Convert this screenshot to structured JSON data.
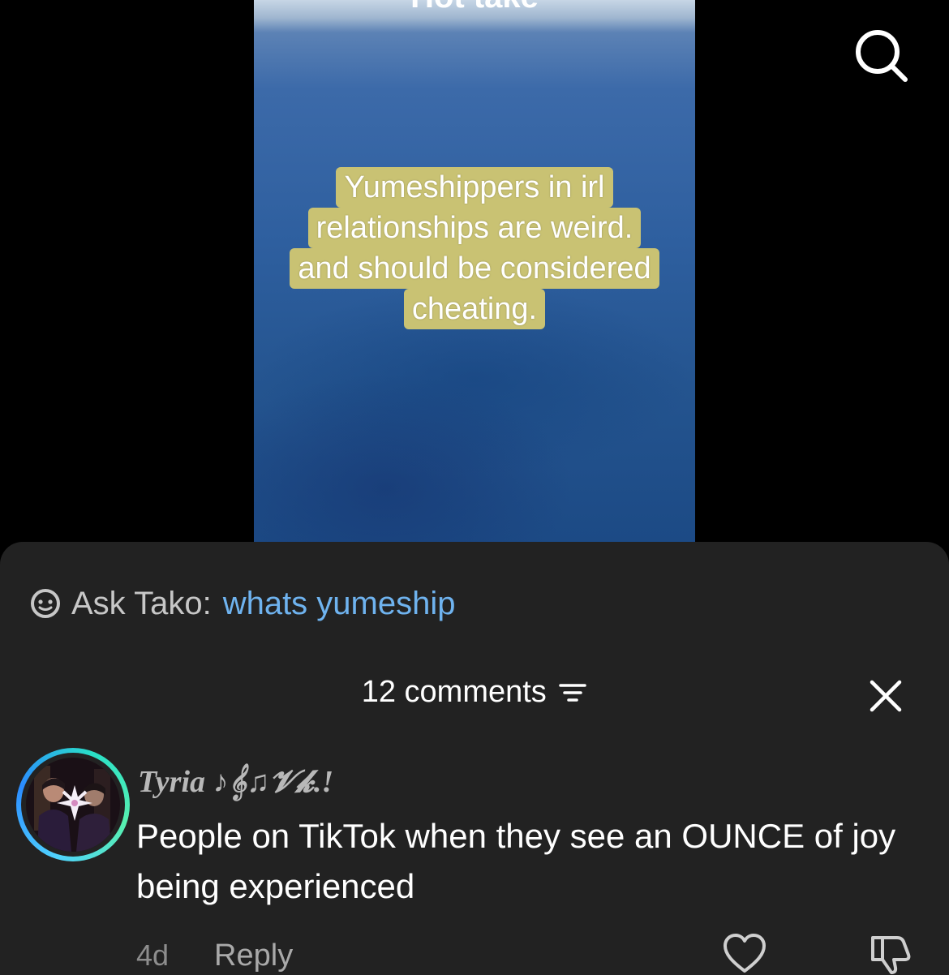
{
  "video": {
    "title": "Hot take",
    "caption_lines": [
      "Yumeshippers in irl",
      "relationships are weird.",
      "and should be considered",
      "cheating."
    ]
  },
  "top_bar": {
    "search_icon": "search-icon"
  },
  "ask_tako": {
    "icon": "tako-icon",
    "label": "Ask Tako:",
    "query": "whats yumeship"
  },
  "comments": {
    "count_label": "12 comments",
    "filter_icon": "filter-icon",
    "close_icon": "close-icon",
    "items": [
      {
        "username": "Tyria ♪𝄞♫𝓥𝓴.!",
        "text": "People on TikTok when they see an OUNCE of joy being experienced",
        "time": "4d",
        "reply_label": "Reply",
        "like_icon": "heart-icon",
        "dislike_icon": "thumbs-down-icon"
      }
    ]
  },
  "colors": {
    "sheet_bg": "#222222",
    "ask_query": "#6fb3ef",
    "caption_bg": "#c9c273",
    "avatar_ring": "#4fd1ff"
  }
}
